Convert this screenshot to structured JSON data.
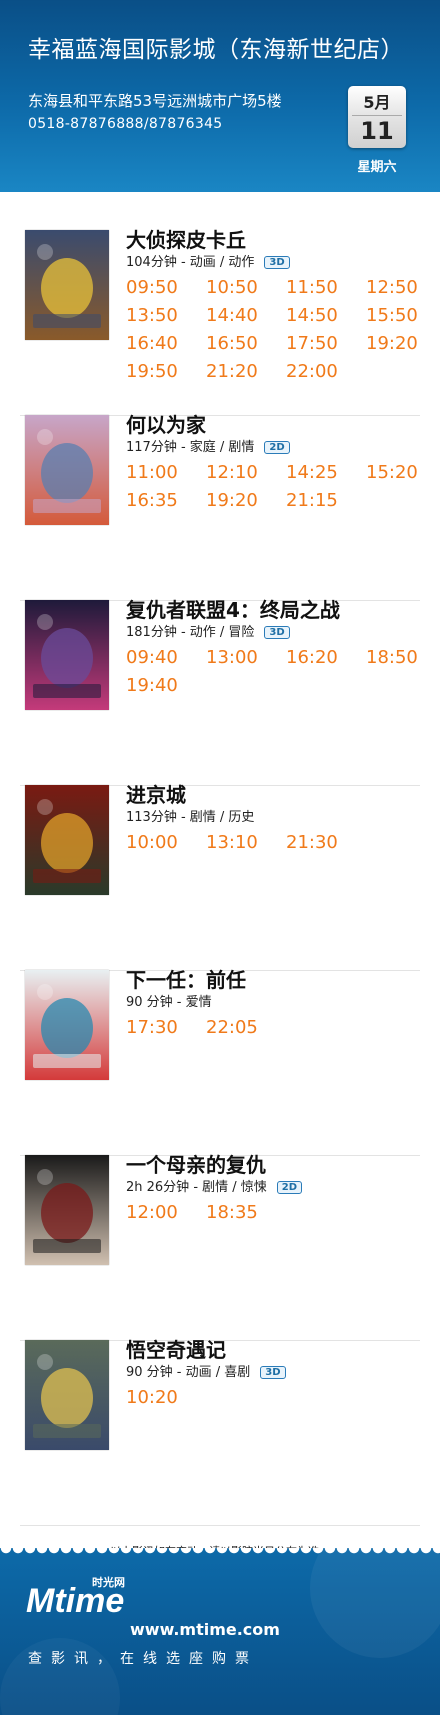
{
  "header": {
    "cinema_name": "幸福蓝海国际影城（东海新世纪店）",
    "address": "东海县和平东路53号远洲城市广场5楼",
    "phone": "0518-87876888/87876345",
    "date": {
      "month": "5月",
      "day": "11",
      "weekday": "星期六"
    }
  },
  "movies": [
    {
      "title": "大侦探皮卡丘",
      "meta": "104分钟 - 动画 / 动作",
      "format": "3D",
      "poster_colors": [
        "#3a4b6e",
        "#e8c23a",
        "#8a5a2a"
      ],
      "times": [
        "09:50",
        "10:50",
        "11:50",
        "12:50",
        "13:50",
        "14:40",
        "14:50",
        "15:50",
        "16:40",
        "16:50",
        "17:50",
        "19:20",
        "19:50",
        "21:20",
        "22:00"
      ]
    },
    {
      "title": "何以为家",
      "meta": "117分钟 - 家庭 / 剧情",
      "format": "2D",
      "poster_colors": [
        "#c7a6c9",
        "#5a7fb0",
        "#d45a3a"
      ],
      "times": [
        "11:00",
        "12:10",
        "14:25",
        "15:20",
        "16:35",
        "19:20",
        "21:15"
      ]
    },
    {
      "title": "复仇者联盟4：终局之战",
      "meta": "181分钟 - 动作 / 冒险",
      "format": "3D",
      "poster_colors": [
        "#1e1a3a",
        "#6a4b9a",
        "#c43a7a"
      ],
      "times": [
        "09:40",
        "13:00",
        "16:20",
        "18:50",
        "19:40"
      ]
    },
    {
      "title": "进京城",
      "meta": "113分钟 - 剧情 / 历史",
      "format": "",
      "poster_colors": [
        "#7a1a12",
        "#e0a02a",
        "#2a3a2a"
      ],
      "times": [
        "10:00",
        "13:10",
        "21:30"
      ]
    },
    {
      "title": "下一任：前任",
      "meta": "90 分钟 - 爱情",
      "format": "",
      "poster_colors": [
        "#e8f0f2",
        "#2a8ab0",
        "#d43a3a"
      ],
      "times": [
        "17:30",
        "22:05"
      ]
    },
    {
      "title": "一个母亲的复仇",
      "meta": "2h 26分钟 - 剧情 / 惊悚",
      "format": "2D",
      "poster_colors": [
        "#1a1a1a",
        "#7a1a1a",
        "#d0c0b0"
      ],
      "times": [
        "12:00",
        "18:35"
      ]
    },
    {
      "title": "悟空奇遇记",
      "meta": "90 分钟 - 动画 / 喜剧",
      "format": "3D",
      "poster_colors": [
        "#5a6a5a",
        "#e0c050",
        "#3a4a6a"
      ],
      "times": [
        "10:20"
      ]
    }
  ],
  "footer": {
    "notice": "以上影讯如有变动，请以影院当日公布为准。",
    "logo_main": "Mtime",
    "logo_cn": "时光网",
    "url": "www.mtime.com",
    "slogan": "查影讯，在线选座购票"
  },
  "colors": {
    "header_blue": "#0a4f87",
    "showtime_orange": "#f07a1a",
    "format_badge_blue": "#2a7bb8"
  }
}
